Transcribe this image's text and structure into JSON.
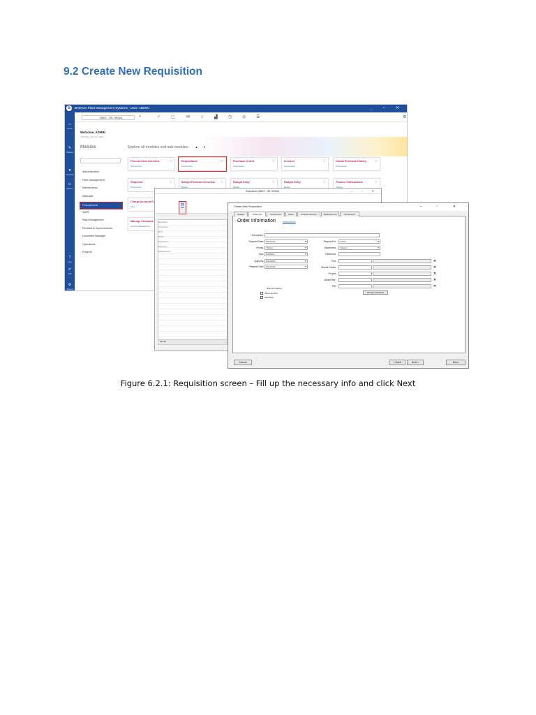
{
  "heading": "9.2 Create New Requisition",
  "caption": "Figure 6.2.1: Requisition screen – Fill up the necessary info and click Next",
  "app": {
    "title": "BADrum Fleet Management Systems - User: ADMIN",
    "logo": "b",
    "window_controls": "_ ▫ ✕",
    "vessel_combo": "SBDT - IRL SRIDA",
    "toolbar_icons": [
      "search-icon",
      "check-icon",
      "chat-icon",
      "mail-icon",
      "star-icon",
      "chart-icon",
      "clock-icon",
      "globe-icon",
      "list-icon",
      "settings-icon"
    ],
    "sidebar": [
      {
        "icon": "⌂",
        "label": "Home"
      },
      {
        "icon": "✎",
        "label": "Widgets"
      },
      {
        "icon": "★",
        "label": "Favorites"
      },
      {
        "icon": "▭",
        "label": "Monitor"
      },
      {
        "icon": "?",
        "label": "Help"
      },
      {
        "icon": "✐",
        "label": "Edit"
      },
      {
        "icon": "⚙",
        "label": "Settings"
      }
    ],
    "welcome": "Welcome, ADMIN",
    "welcome_sub": "Thursday, June 21, 2022",
    "modules_title": "Modules",
    "explore": "Explore all modules and sub-modules",
    "explore_arrows": "▲ ▼",
    "modules": [
      {
        "label": "Administration",
        "selected": false
      },
      {
        "label": "Fleet Management",
        "selected": false
      },
      {
        "label": "Maintenance",
        "selected": false
      },
      {
        "label": "Materials",
        "selected": false
      },
      {
        "label": "Procurement",
        "selected": true
      },
      {
        "label": "SAFE",
        "selected": false
      },
      {
        "label": "Risk Management",
        "selected": false
      },
      {
        "label": "Reviews & Improvements",
        "selected": false
      },
      {
        "label": "Document Manager",
        "selected": false
      },
      {
        "label": "Operations",
        "selected": false
      },
      {
        "label": "Projects",
        "selected": false
      }
    ],
    "cards": [
      {
        "title": "Procurement Overview",
        "sub": "Procurement"
      },
      {
        "title": "Requisitions",
        "sub": "Procurement",
        "highlight": true
      },
      {
        "title": "Purchase Orders",
        "sub": "Procurement"
      },
      {
        "title": "Invoices",
        "sub": "Procurement"
      },
      {
        "title": "Global Purchase History",
        "sub": "Procurement"
      },
      {
        "title": "Shipment",
        "sub": "Procurement"
      },
      {
        "title": "Budget Forecast Overview",
        "sub": "Budget"
      },
      {
        "title": "Budget Entry",
        "sub": "Budget"
      },
      {
        "title": "Budget Entry",
        "sub": "Budget"
      },
      {
        "title": "Finance Transactions",
        "sub": "Finance"
      },
      {
        "title": "Charge Account R...",
        "sub": "Fleet"
      },
      {
        "title": "Manage Contracts",
        "sub": "Contract Management"
      }
    ]
  },
  "req_window": {
    "title": "Requisition (SBDT - IRL SRIDA)",
    "window_controls": "– ▫ ✕",
    "new_label": "New",
    "record_label": "Record",
    "field_labels": [
      "Requisition",
      "Component",
      "Ref #",
      "Priority",
      "Department",
      "Reference",
      "Requested For"
    ]
  },
  "dialog": {
    "title": "Create New Requisition",
    "window_controls": "– ▫ ✕",
    "tabs": [
      "Header",
      "Order Info",
      "Component",
      "Items",
      "Finance Account",
      "Additional Info",
      "Documents"
    ],
    "active_tab": "Order Info",
    "section_title": "Order Information",
    "instructions": "Instructions",
    "left_fields": [
      {
        "label": "* Description:",
        "value": ""
      },
      {
        "label": "Required Date:",
        "value": "6/21/2022"
      },
      {
        "label": "Priority:",
        "value": "<None>"
      },
      {
        "label": "Type:",
        "value": "NORMAL"
      },
      {
        "label": "Apply By:",
        "value": "6/21/2022"
      },
      {
        "label": "* Request Date:",
        "value": "6/21/2022"
      }
    ],
    "right_fields_a": [
      {
        "label": "Request For:",
        "value": "Vessel"
      },
      {
        "label": "Department:",
        "value": "<None>"
      },
      {
        "label": "Reference:",
        "value": ""
      }
    ],
    "right_fields_b": [
      {
        "label": "Port:",
        "value": ""
      },
      {
        "label": "Service Center:",
        "value": ""
      },
      {
        "label": "Project:",
        "value": ""
      },
      {
        "label": "Linked Req.:",
        "value": ""
      },
      {
        "label": "PIC:",
        "value": ""
      }
    ],
    "bulk_label": "Bulk Purchasing",
    "checkboxes": [
      "Same as Wolf",
      "DPA Flag"
    ],
    "manage_button": "Manage Schedule",
    "cancel_button": "Cancel",
    "back_button": "< Back",
    "next_button": "Next >",
    "done_button": "Done"
  }
}
